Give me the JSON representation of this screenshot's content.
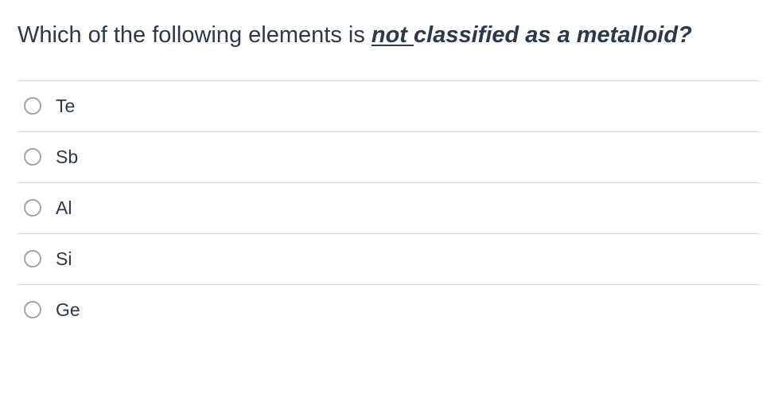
{
  "question": {
    "prefix": "Which of the following elements is ",
    "emphasis_underline": "not ",
    "emphasis_rest": "classified as a metalloid?"
  },
  "options": [
    {
      "label": "Te"
    },
    {
      "label": "Sb"
    },
    {
      "label": "Al"
    },
    {
      "label": "Si"
    },
    {
      "label": "Ge"
    }
  ]
}
